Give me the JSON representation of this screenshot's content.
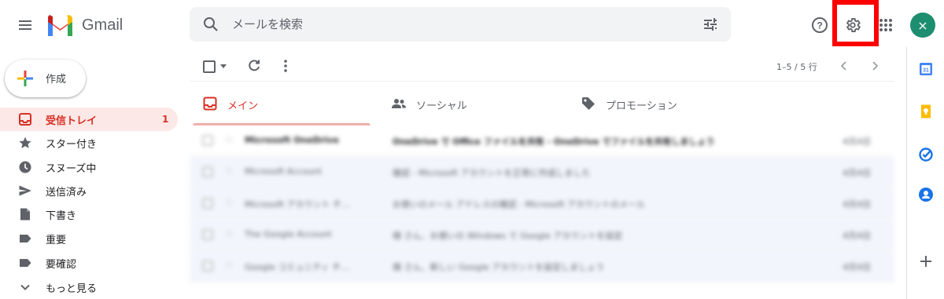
{
  "header": {
    "app_name": "Gmail",
    "search_placeholder": "メールを検索",
    "avatar_glyph": "×",
    "settings_highlight_color": "#ff0000"
  },
  "sidebar": {
    "compose_label": "作成",
    "items": [
      {
        "label": "受信トレイ",
        "icon": "inbox-icon",
        "count": "1",
        "active": true
      },
      {
        "label": "スター付き",
        "icon": "star-icon"
      },
      {
        "label": "スヌーズ中",
        "icon": "clock-icon"
      },
      {
        "label": "送信済み",
        "icon": "send-icon"
      },
      {
        "label": "下書き",
        "icon": "draft-icon"
      },
      {
        "label": "重要",
        "icon": "label-icon"
      },
      {
        "label": "要確認",
        "icon": "label-icon"
      },
      {
        "label": "もっと見る",
        "icon": "chevron-down-icon"
      }
    ]
  },
  "toolbar": {
    "pager": "1–5 / 5 行"
  },
  "tabs": [
    {
      "label": "メイン",
      "icon": "inbox-icon",
      "active": true
    },
    {
      "label": "ソーシャル",
      "icon": "people-icon"
    },
    {
      "label": "プロモーション",
      "icon": "tag-icon"
    }
  ],
  "emails": [
    {
      "sender": "Microsoft OneDrive",
      "subject": "OneDrive で Office ファイルを共有 - OneDrive でファイルを共有しましょう",
      "date": "4月4日"
    },
    {
      "sender": "Microsoft Account",
      "subject": "確認 - Microsoft アカウントを正常に作成しました",
      "date": "4月4日"
    },
    {
      "sender": "Microsoft アカウント チ…",
      "subject": "お使いのメール アドレスの確認 - Microsoft アカウントのメール",
      "date": "4月4日"
    },
    {
      "sender": "The Google Account",
      "subject": "様 さん、お使いの Windows で Google アカウントを設定",
      "date": "4月4日"
    },
    {
      "sender": "Google コミュニティ チ…",
      "subject": "様 さん、新しい Google アカウントを設定しましょう",
      "date": "4月4日"
    }
  ],
  "colors": {
    "accent_red": "#d93025",
    "active_bg": "#fce8e6",
    "avatar_bg": "#1e8e70"
  }
}
